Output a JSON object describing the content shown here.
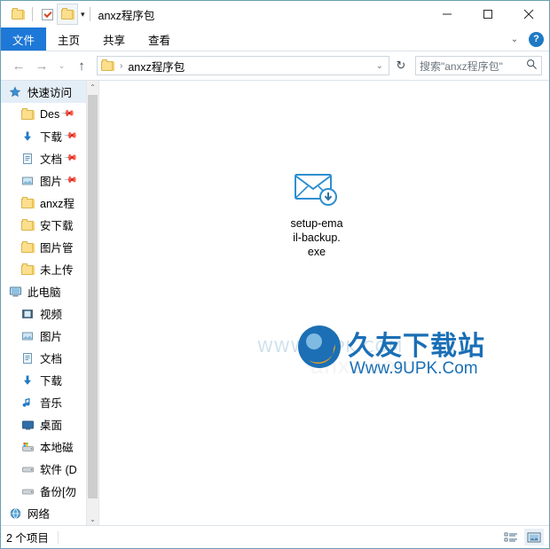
{
  "window": {
    "title": "anxz程序包",
    "quick_access_toolbar": [
      {
        "name": "folder-properties",
        "icon": "folder-icon"
      },
      {
        "name": "properties-checkbox",
        "icon": "checkbox-icon"
      },
      {
        "name": "new-folder",
        "icon": "folder-icon"
      }
    ],
    "controls": {
      "minimize": "minimize-icon",
      "maximize": "maximize-icon",
      "close": "close-icon"
    }
  },
  "ribbon": {
    "tabs": [
      {
        "label": "文件",
        "active": true
      },
      {
        "label": "主页",
        "active": false
      },
      {
        "label": "共享",
        "active": false
      },
      {
        "label": "查看",
        "active": false
      }
    ],
    "expand_icon": "chevron-down-icon",
    "help_label": "?"
  },
  "address_bar": {
    "back_icon": "←",
    "forward_icon": "→",
    "history_icon": "⌄",
    "up_icon": "↑",
    "breadcrumb": [
      {
        "label": "anxz程序包",
        "icon": "folder-icon"
      }
    ],
    "dropdown_icon": "⌄",
    "refresh_icon": "↻"
  },
  "search": {
    "placeholder": "搜索\"anxz程序包\"",
    "value": "",
    "icon": "search-icon"
  },
  "sidebar": {
    "groups": [
      {
        "name": "quick-access",
        "root": {
          "label": "快速访问",
          "icon": "star-icon",
          "selected": true
        },
        "items": [
          {
            "label": "Des",
            "icon": "folder-icon",
            "pinned": true
          },
          {
            "label": "下载",
            "icon": "download-icon",
            "pinned": true
          },
          {
            "label": "文档",
            "icon": "document-icon",
            "pinned": true
          },
          {
            "label": "图片",
            "icon": "picture-icon",
            "pinned": true
          },
          {
            "label": "anxz程",
            "icon": "folder-icon",
            "pinned": false
          },
          {
            "label": "安下载",
            "icon": "folder-icon",
            "pinned": false
          },
          {
            "label": "图片管",
            "icon": "folder-icon",
            "pinned": false
          },
          {
            "label": "未上传",
            "icon": "folder-icon",
            "pinned": false
          }
        ]
      },
      {
        "name": "this-pc",
        "root": {
          "label": "此电脑",
          "icon": "computer-icon",
          "selected": false
        },
        "items": [
          {
            "label": "视频",
            "icon": "video-icon",
            "pinned": false
          },
          {
            "label": "图片",
            "icon": "picture-icon",
            "pinned": false
          },
          {
            "label": "文档",
            "icon": "document-icon",
            "pinned": false
          },
          {
            "label": "下载",
            "icon": "download-icon",
            "pinned": false
          },
          {
            "label": "音乐",
            "icon": "music-icon",
            "pinned": false
          },
          {
            "label": "桌面",
            "icon": "desktop-icon",
            "pinned": false
          },
          {
            "label": "本地磁",
            "icon": "system-drive-icon",
            "pinned": false
          },
          {
            "label": "软件 (D",
            "icon": "drive-icon",
            "pinned": false
          },
          {
            "label": "备份[勿",
            "icon": "drive-icon",
            "pinned": false
          }
        ]
      },
      {
        "name": "network",
        "root": {
          "label": "网络",
          "icon": "network-icon",
          "selected": false
        },
        "items": []
      }
    ],
    "scrollbar": {
      "up_icon": "⌃",
      "down_icon": "⌄"
    }
  },
  "content": {
    "files": [
      {
        "name": "setup-email-backup.exe",
        "display_lines": [
          "setup-ema",
          "il-backup.",
          "exe"
        ],
        "icon": "email-download-icon"
      }
    ],
    "watermark": {
      "background_text": "WWW.9UPK.COM",
      "faint_text": "anxz.com",
      "title": "久友下载站",
      "url": "Www.9UPK.Com",
      "logo_colors": {
        "blue": "#1a6fb5",
        "orange": "#f0a21e"
      }
    }
  },
  "status_bar": {
    "item_count": "2 个项目",
    "views": [
      {
        "name": "details-view",
        "icon": "details-icon",
        "active": false
      },
      {
        "name": "large-icons-view",
        "icon": "thumbnails-icon",
        "active": true
      }
    ]
  },
  "colors": {
    "accent": "#1e78d7",
    "window_border": "#6b9fb5",
    "selection": "#e4eef7",
    "folder": "#fcdf8d"
  }
}
